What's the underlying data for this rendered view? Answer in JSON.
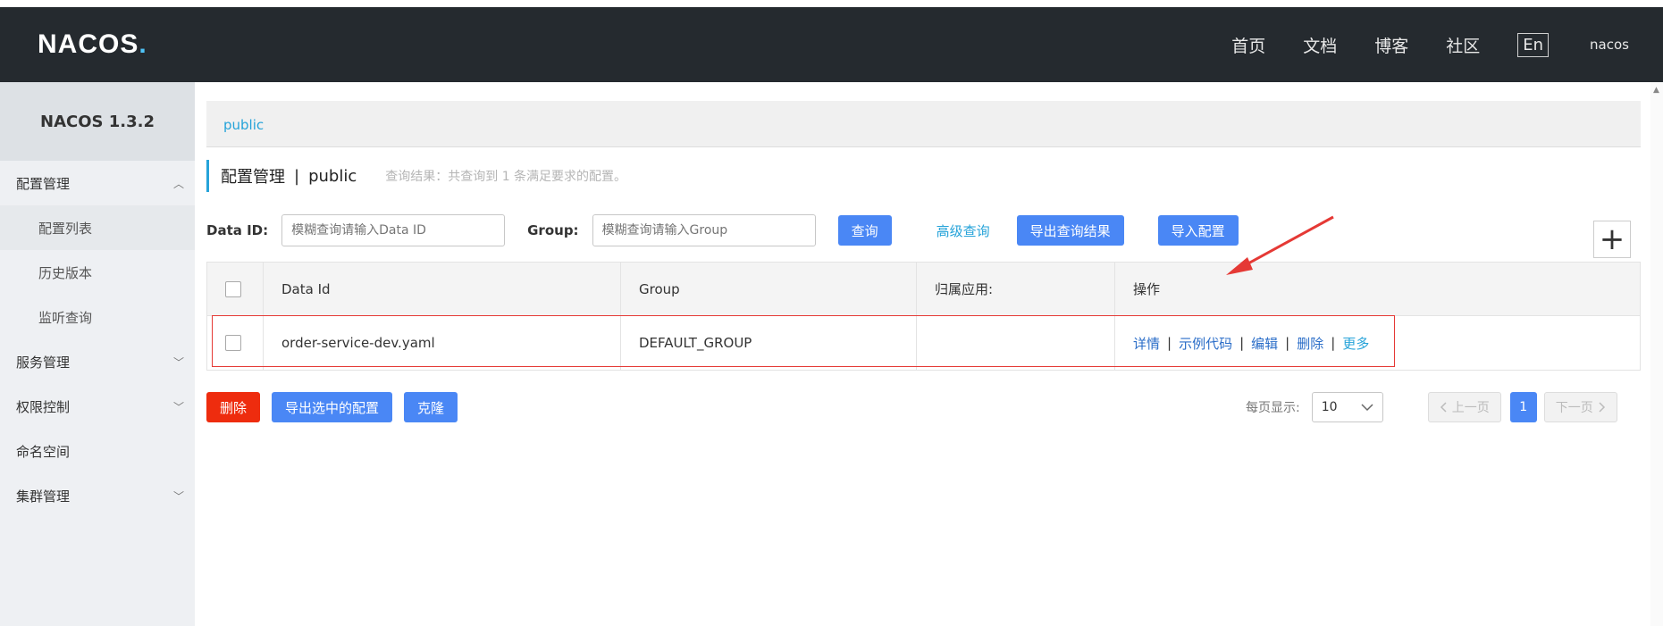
{
  "header": {
    "logo": "NACOS",
    "logo_dot": ".",
    "nav": [
      "首页",
      "文档",
      "博客",
      "社区"
    ],
    "lang": "En",
    "user": "nacos"
  },
  "sidebar": {
    "version": "NACOS 1.3.2",
    "items": [
      {
        "label": "配置管理",
        "icon": "chevron-up-icon",
        "glyph": "︿"
      },
      {
        "label": "配置列表"
      },
      {
        "label": "历史版本"
      },
      {
        "label": "监听查询"
      },
      {
        "label": "服务管理",
        "icon": "chevron-down-icon",
        "glyph": "﹀"
      },
      {
        "label": "权限控制",
        "icon": "chevron-down-icon",
        "glyph": "﹀"
      },
      {
        "label": "命名空间"
      },
      {
        "label": "集群管理",
        "icon": "chevron-down-icon",
        "glyph": "﹀"
      }
    ]
  },
  "namespace_bar": {
    "current": "public"
  },
  "page": {
    "title": "配置管理",
    "separator": "|",
    "namespace": "public",
    "result": "查询结果：共查询到 1 条满足要求的配置。"
  },
  "filter": {
    "data_id_label": "Data ID:",
    "data_id_placeholder": "模糊查询请输入Data ID",
    "group_label": "Group:",
    "group_placeholder": "模糊查询请输入Group",
    "query_button": "查询",
    "advanced_query": "高级查询",
    "export_result_button": "导出查询结果",
    "import_button": "导入配置",
    "add_glyph": "+"
  },
  "table": {
    "headers": [
      "Data Id",
      "Group",
      "归属应用:",
      "操作"
    ],
    "rows": [
      {
        "data_id": "order-service-dev.yaml",
        "group": "DEFAULT_GROUP",
        "app": "",
        "ops": [
          "详情",
          "示例代码",
          "编辑",
          "删除",
          "更多"
        ]
      }
    ],
    "pipe": "|"
  },
  "bottom": {
    "delete_button": "删除",
    "export_selected_button": "导出选中的配置",
    "clone_button": "克隆"
  },
  "pager": {
    "per_page_label": "每页显示:",
    "per_page_value": "10",
    "prev": "上一页",
    "next": "下一页",
    "current_page": "1"
  },
  "colors": {
    "accent": "#4a87f5",
    "danger": "#ee2c0e",
    "link": "#26a3d9",
    "annotation": "#e53935"
  }
}
